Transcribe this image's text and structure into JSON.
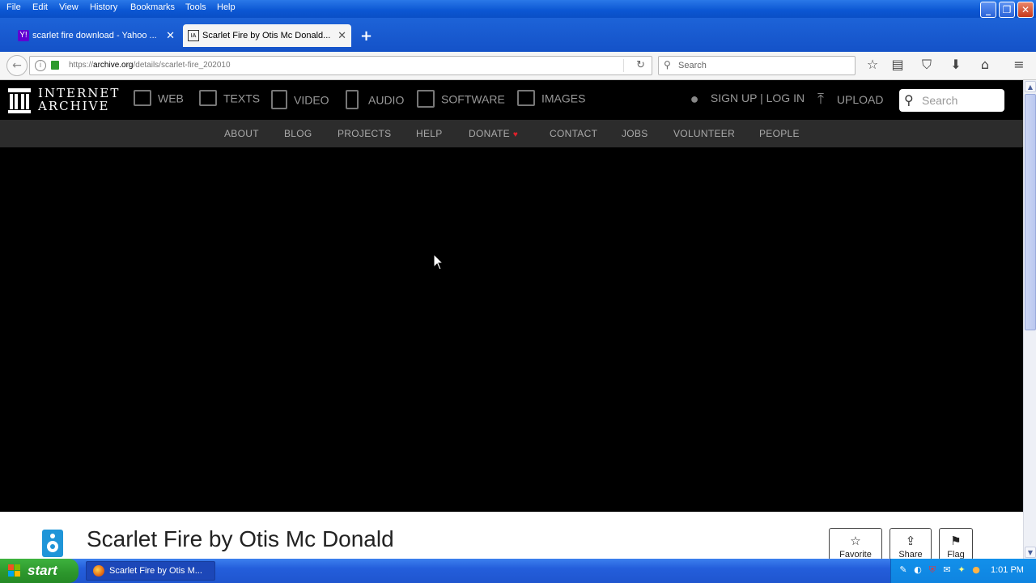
{
  "browser": {
    "menu": [
      "File",
      "Edit",
      "View",
      "History",
      "Bookmarks",
      "Tools",
      "Help"
    ],
    "tabs": [
      {
        "label": "scarlet fire download - Yahoo ...",
        "favicon": "Y!"
      },
      {
        "label": "Scarlet Fire by Otis Mc Donald...",
        "favicon": "IA"
      }
    ],
    "new_tab": "+",
    "address": {
      "prefix": "https://",
      "host": "archive.org",
      "path": "/details/scarlet-fire_202010"
    },
    "search_placeholder": "Search"
  },
  "ia": {
    "brand_line1": "INTERNET",
    "brand_line2": "ARCHIVE",
    "nav": [
      "WEB",
      "TEXTS",
      "VIDEO",
      "AUDIO",
      "SOFTWARE",
      "IMAGES"
    ],
    "user": "SIGN UP | LOG IN",
    "upload": "UPLOAD",
    "search_placeholder": "Search",
    "subnav": [
      "ABOUT",
      "BLOG",
      "PROJECTS",
      "HELP",
      "DONATE",
      "CONTACT",
      "JOBS",
      "VOLUNTEER",
      "PEOPLE"
    ]
  },
  "item": {
    "title": "Scarlet Fire by Otis Mc Donald",
    "actions": [
      "Favorite",
      "Share",
      "Flag"
    ]
  },
  "taskbar": {
    "start": "start",
    "window": "Scarlet Fire by Otis M...",
    "clock": "1:01 PM"
  },
  "colors": {
    "xp_blue": "#0b56d2",
    "ia_black": "#000000",
    "ia_subnav": "#2c2c2c",
    "audio_blue": "#1f95d8",
    "donate_heart": "#e0202a"
  }
}
